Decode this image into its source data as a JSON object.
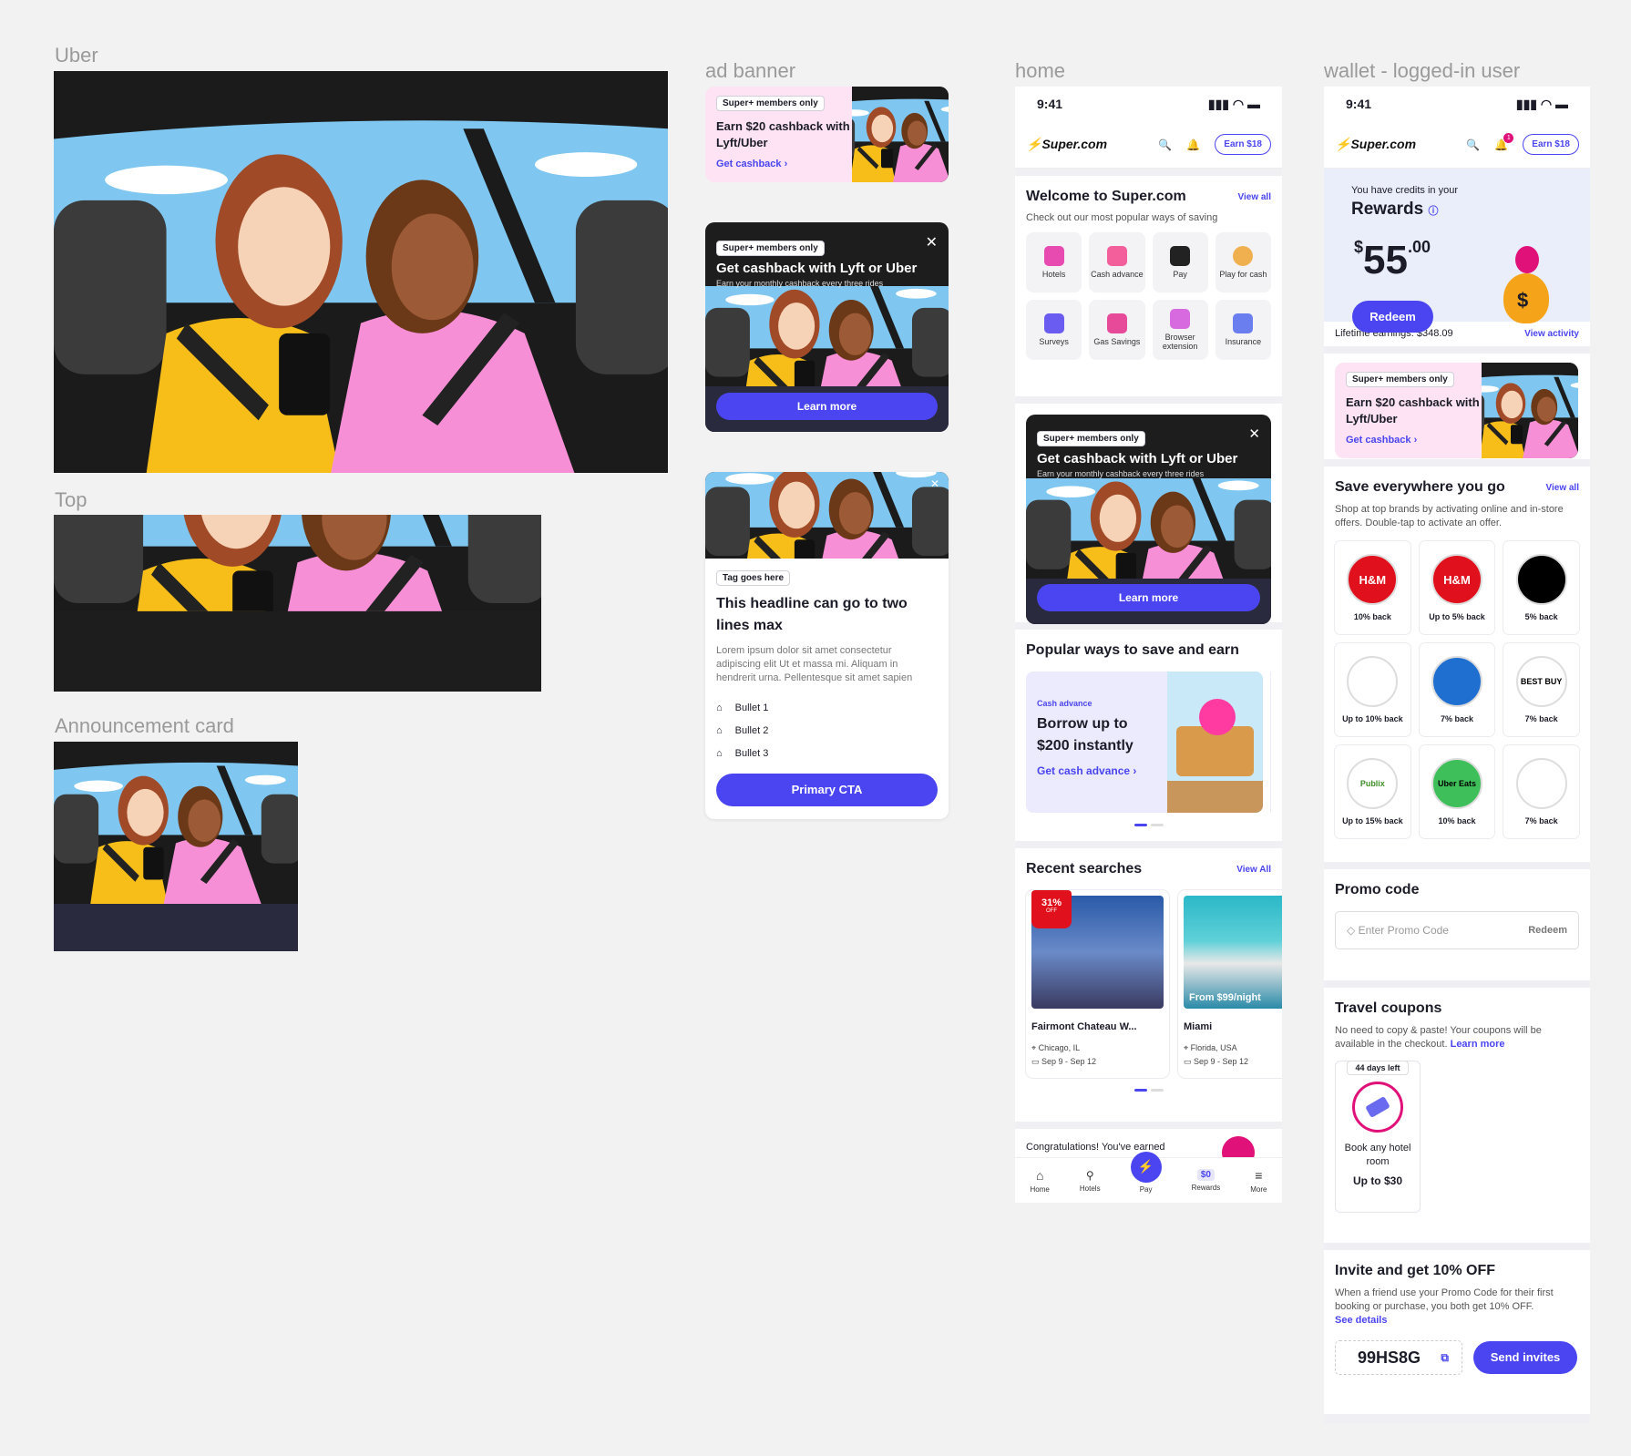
{
  "labels": {
    "uber": "Uber",
    "top": "Top",
    "announcement_card_left": "Announcement card",
    "ad_banner": "ad banner",
    "announcement_card": "announcement card",
    "home": "home",
    "wallet": "wallet - logged-in user"
  },
  "ad_banner": {
    "tag": "Super+ members only",
    "title": "Earn $20 cashback with Lyft/Uber",
    "link": "Get cashback"
  },
  "announcement": {
    "tag": "Super+ members only",
    "title": "Get cashback with Lyft or Uber",
    "subtitle": "Earn your monthly cashback every three rides",
    "cta": "Learn more"
  },
  "content_card": {
    "tag": "Tag goes here",
    "headline": "This headline can go to two lines max",
    "body": "Lorem ipsum dolor sit amet consectetur adipiscing elit Ut et massa mi. Aliquam in hendrerit urna. Pellentesque sit amet sapien",
    "bullets": [
      "Bullet 1",
      "Bullet 2",
      "Bullet 3"
    ],
    "cta": "Primary CTA"
  },
  "home": {
    "time": "9:41",
    "logo": "Super.com",
    "earn": "Earn $18",
    "welcome_title": "Welcome to Super.com",
    "view_all": "View all",
    "welcome_sub": "Check out our most popular ways of saving",
    "tiles": [
      "Hotels",
      "Cash advance",
      "Pay",
      "Play for cash",
      "Surveys",
      "Gas Savings",
      "Browser extension",
      "Insurance"
    ],
    "popular_title": "Popular ways to save and earn",
    "promo_tag": "Cash advance",
    "promo_title": "Borrow up to $200 instantly",
    "promo_link": "Get cash advance",
    "recent_title": "Recent searches",
    "recent_view_all": "View All",
    "hotels": [
      {
        "name": "Fairmont Chateau W...",
        "loc": "Chicago, IL",
        "dates": "Sep 9 - Sep 12",
        "badge": "31%",
        "badge_sub": "OFF"
      },
      {
        "name": "Miami",
        "loc": "Florida, USA",
        "dates": "Sep 9 - Sep 12",
        "price": "From $99/night"
      }
    ],
    "congrats": "Congratulations! You've earned",
    "nav": [
      "Home",
      "Hotels",
      "Pay",
      "Rewards",
      "More"
    ],
    "nav_rewards_badge": "$0"
  },
  "wallet": {
    "time": "9:41",
    "logo": "Super.com",
    "earn": "Earn $18",
    "notif": "1",
    "credits_text": "You have credits in your",
    "rewards": "Rewards",
    "amount_currency": "$",
    "amount_whole": "55",
    "amount_cents": ".00",
    "redeem": "Redeem",
    "lifetime": "Lifetime earnings: $348.09",
    "view_activity": "View activity",
    "save_title": "Save everywhere you go",
    "save_view_all": "View all",
    "save_sub": "Shop at top brands by activating online and in-store offers. Double-tap to activate an offer.",
    "brands": [
      {
        "logo": "H&M",
        "text": "10% back",
        "bg": "#e0101c",
        "fg": "#ffffff"
      },
      {
        "logo": "H&M",
        "text": "Up to 5% back",
        "bg": "#e0101c",
        "fg": "#ffffff"
      },
      {
        "logo": "",
        "text": "5% back",
        "bg": "#000000",
        "fg": "#ffffff"
      },
      {
        "logo": "",
        "text": "Up to 10% back",
        "bg": "#ffffff",
        "fg": "#000000"
      },
      {
        "logo": "",
        "text": "7% back",
        "bg": "#1f6fd1",
        "fg": "#ffc220"
      },
      {
        "logo": "BEST BUY",
        "text": "7% back",
        "bg": "#ffffff",
        "fg": "#000000"
      },
      {
        "logo": "Publix",
        "text": "Up to 15% back",
        "bg": "#ffffff",
        "fg": "#3f8f29"
      },
      {
        "logo": "Uber Eats",
        "text": "10% back",
        "bg": "#3fbf5a",
        "fg": "#000000"
      },
      {
        "logo": "",
        "text": "7% back",
        "bg": "#ffffff",
        "fg": "#cc0000"
      }
    ],
    "promo_title": "Promo code",
    "promo_placeholder": "Enter Promo Code",
    "promo_redeem": "Redeem",
    "travel_title": "Travel coupons",
    "travel_sub": "No need to copy & paste! Your coupons will be available in the checkout.",
    "travel_learn": "Learn more",
    "coupon_days": "44 days left",
    "coupon_text": "Book any hotel room",
    "coupon_value": "Up to $30",
    "invite_title": "Invite and get 10% OFF",
    "invite_sub": "When a friend use your Promo Code for their first booking or purchase, you both get 10% OFF.",
    "invite_details": "See details",
    "invite_code": "99HS8G",
    "send_invites": "Send invites"
  }
}
